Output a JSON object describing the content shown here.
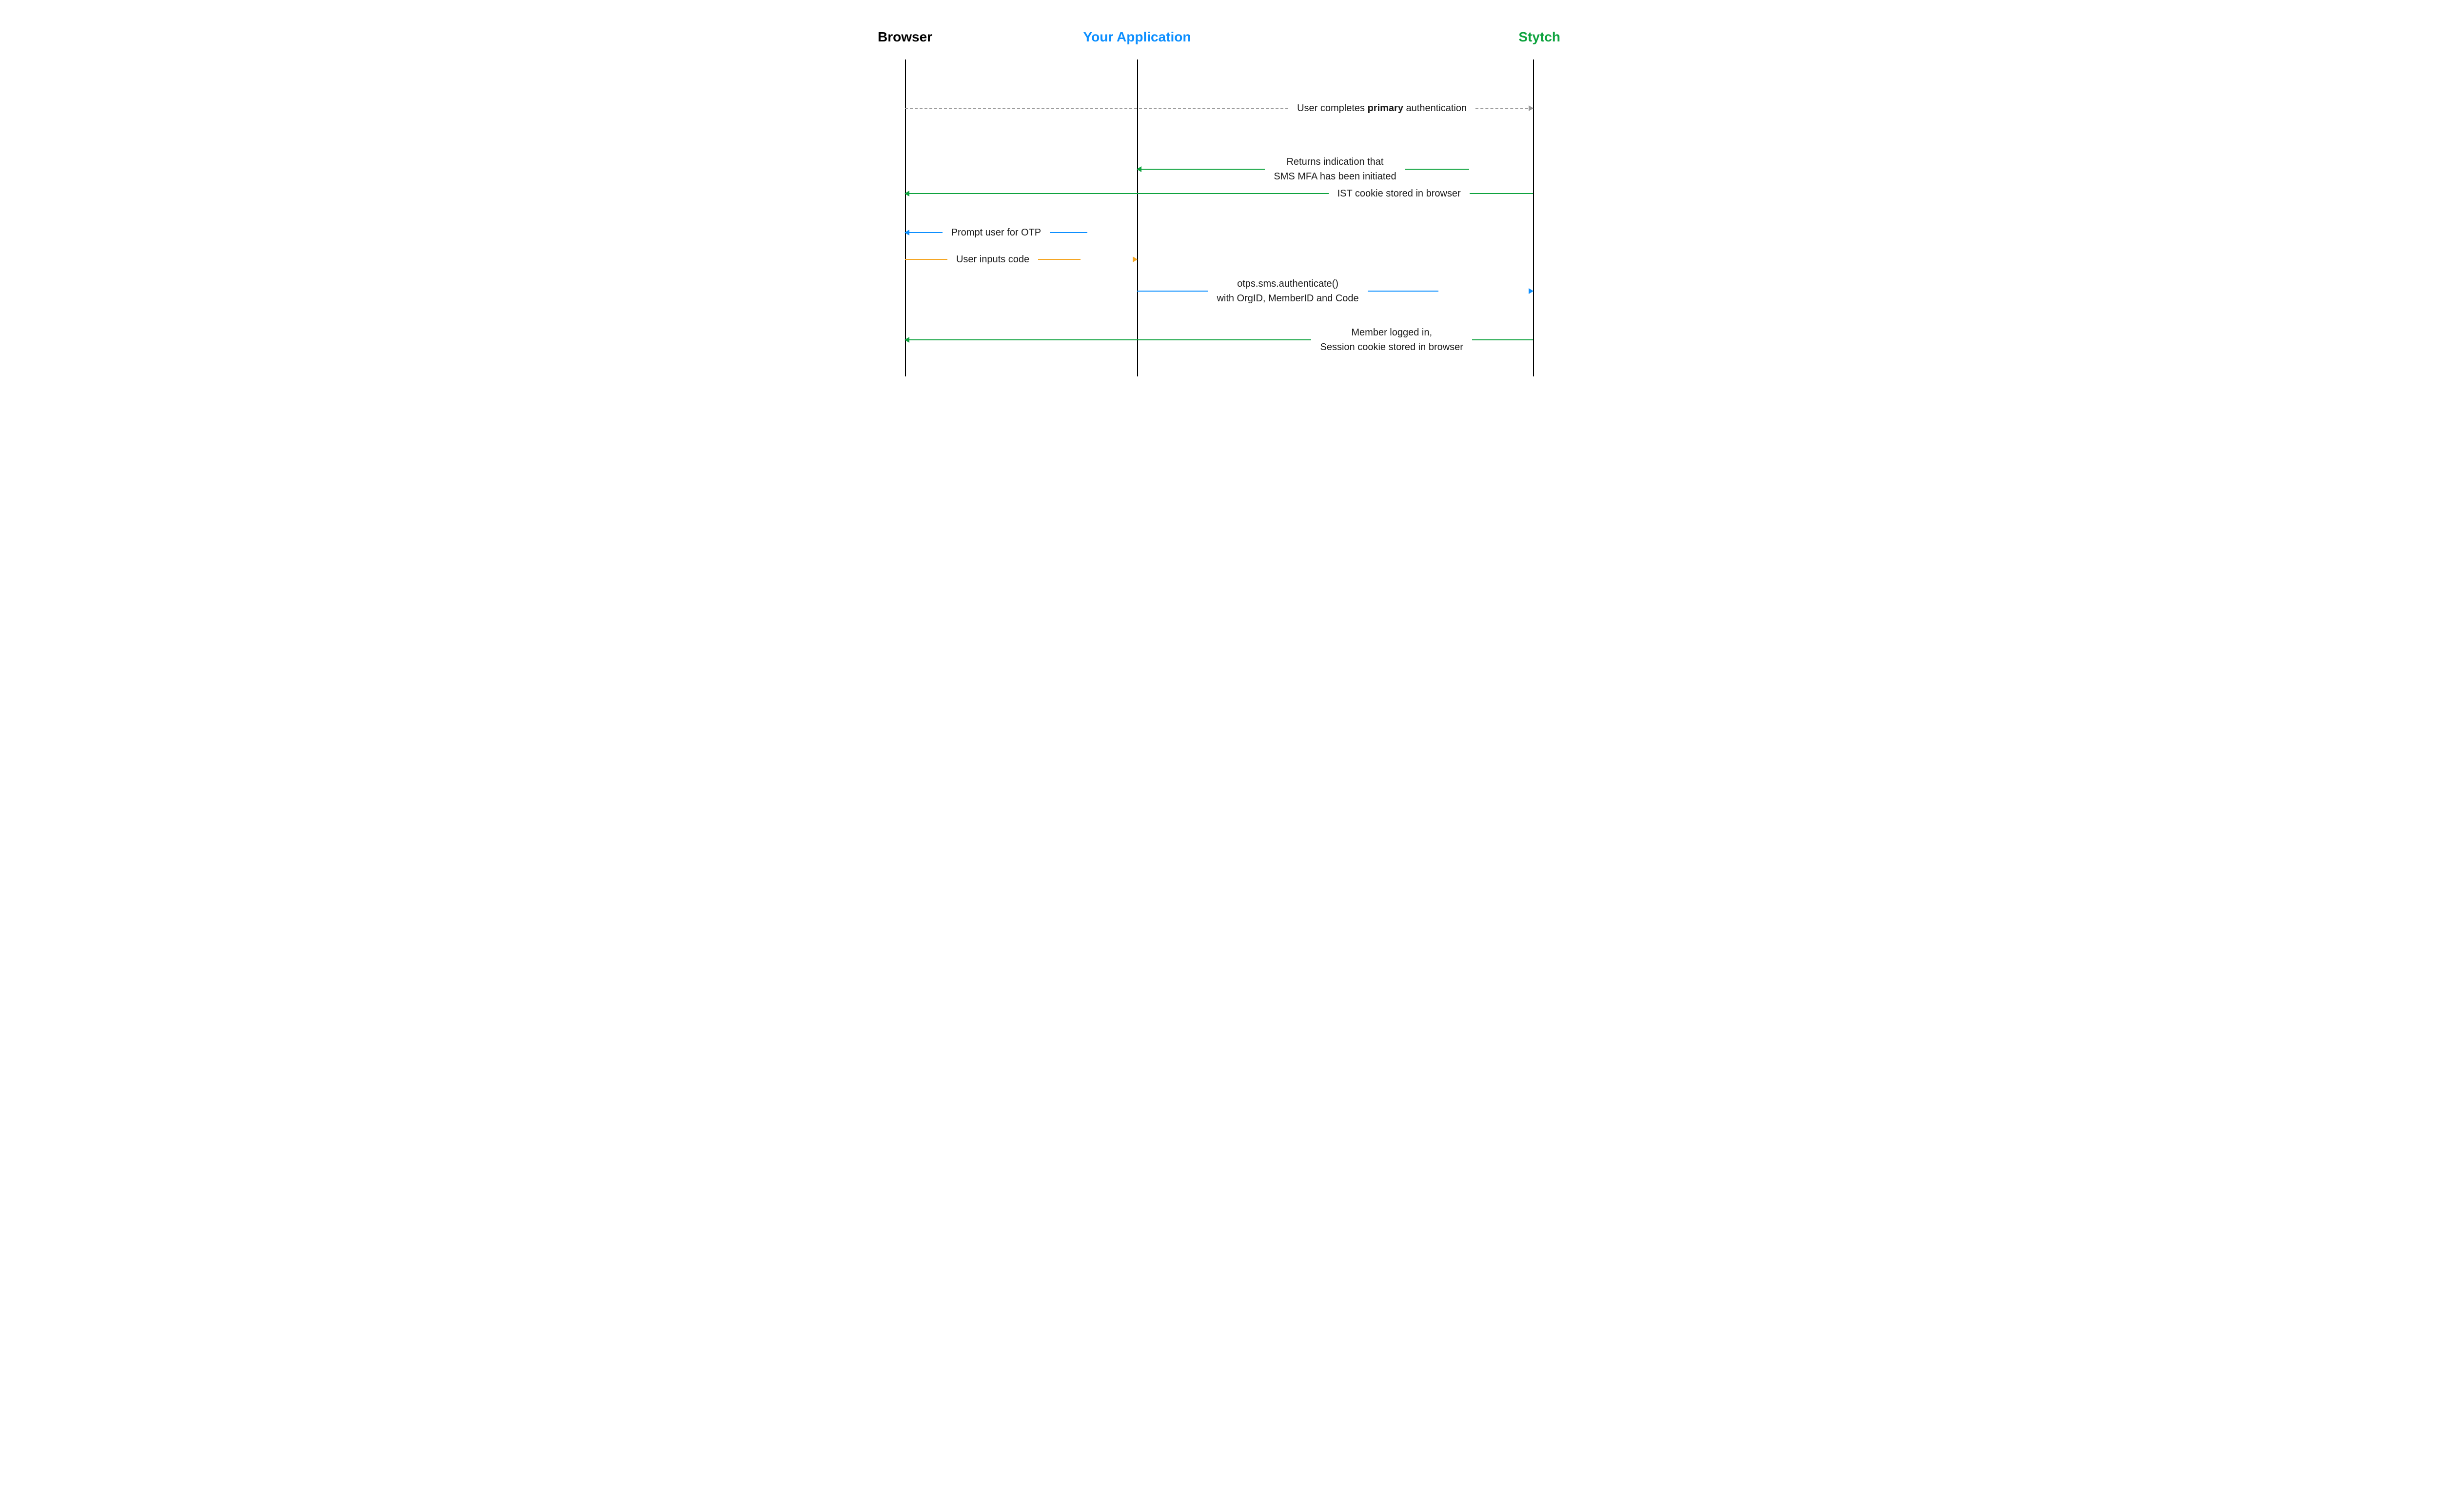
{
  "participants": {
    "browser": "Browser",
    "application": "Your Application",
    "stytch": "Stytch"
  },
  "messages": {
    "primary_auth_pre": "User completes ",
    "primary_auth_bold": "primary",
    "primary_auth_post": " authentication",
    "returns_indication_l1": "Returns indication that",
    "returns_indication_l2": "SMS MFA has been initiated",
    "ist_cookie": "IST cookie stored in browser",
    "prompt_otp": "Prompt user for OTP",
    "user_inputs": "User inputs code",
    "authenticate_l1": "otps.sms.authenticate()",
    "authenticate_l2": "with OrgID, MemberID and Code",
    "logged_in_l1": "Member logged in,",
    "logged_in_l2": "Session cookie stored in browser"
  },
  "colors": {
    "browser": "#000000",
    "application": "#0d8fff",
    "stytch": "#0fa33f",
    "dashed": "#999999",
    "orange": "#f5a623"
  }
}
